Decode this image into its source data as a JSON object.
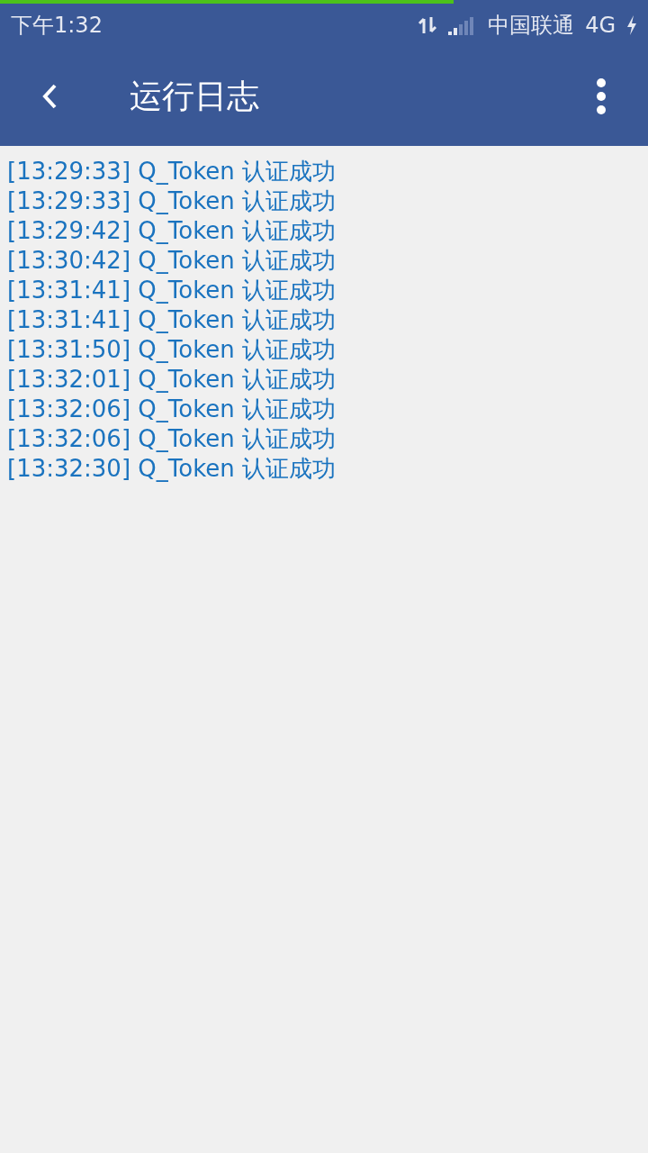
{
  "progress": {
    "level": 0.7
  },
  "status_bar": {
    "time": "下午1:32",
    "carrier": "中国联通",
    "network": "4G"
  },
  "app_bar": {
    "title": "运行日志"
  },
  "log": [
    "[13:29:33] Q_Token 认证成功",
    "[13:29:33] Q_Token 认证成功",
    "[13:29:42] Q_Token 认证成功",
    "[13:30:42] Q_Token 认证成功",
    "[13:31:41] Q_Token 认证成功",
    "[13:31:41] Q_Token 认证成功",
    "[13:31:50] Q_Token 认证成功",
    "[13:32:01] Q_Token 认证成功",
    "[13:32:06] Q_Token 认证成功",
    "[13:32:06] Q_Token 认证成功",
    "[13:32:30] Q_Token 认证成功"
  ]
}
